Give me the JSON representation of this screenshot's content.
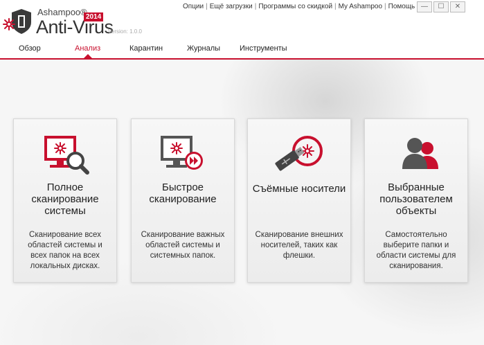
{
  "brand": {
    "company": "Ashampoo®",
    "product": "Anti-Virus",
    "year": "2014",
    "version": "Version: 1.0.0"
  },
  "toplinks": [
    "Опции",
    "Ещё загрузки",
    "Программы со скидкой",
    "My Ashampoo",
    "Помощь"
  ],
  "window_buttons": {
    "minimize": "—",
    "maximize": "☐",
    "close": "✕"
  },
  "tabs": [
    {
      "label": "Обзор"
    },
    {
      "label": "Анализ",
      "active": true
    },
    {
      "label": "Карантин"
    },
    {
      "label": "Журналы"
    },
    {
      "label": "Инструменты"
    }
  ],
  "cards": [
    {
      "icon": "full-scan-icon",
      "title": "Полное сканирование системы",
      "desc": "Сканирование всех областей системы и всех папок на всех локальных дисках."
    },
    {
      "icon": "quick-scan-icon",
      "title": "Быстрое сканирование",
      "desc": "Сканирование важных областей системы и системных папок."
    },
    {
      "icon": "usb-scan-icon",
      "title": "Съёмные носители",
      "desc": "Сканирование внешних носителей, таких как флешки."
    },
    {
      "icon": "custom-scan-icon",
      "title": "Выбранные пользователем объекты",
      "desc": "Самостоятельно выберите папки и области системы для сканирования."
    }
  ],
  "colors": {
    "accent": "#c8102e",
    "icon_gray": "#555555"
  }
}
